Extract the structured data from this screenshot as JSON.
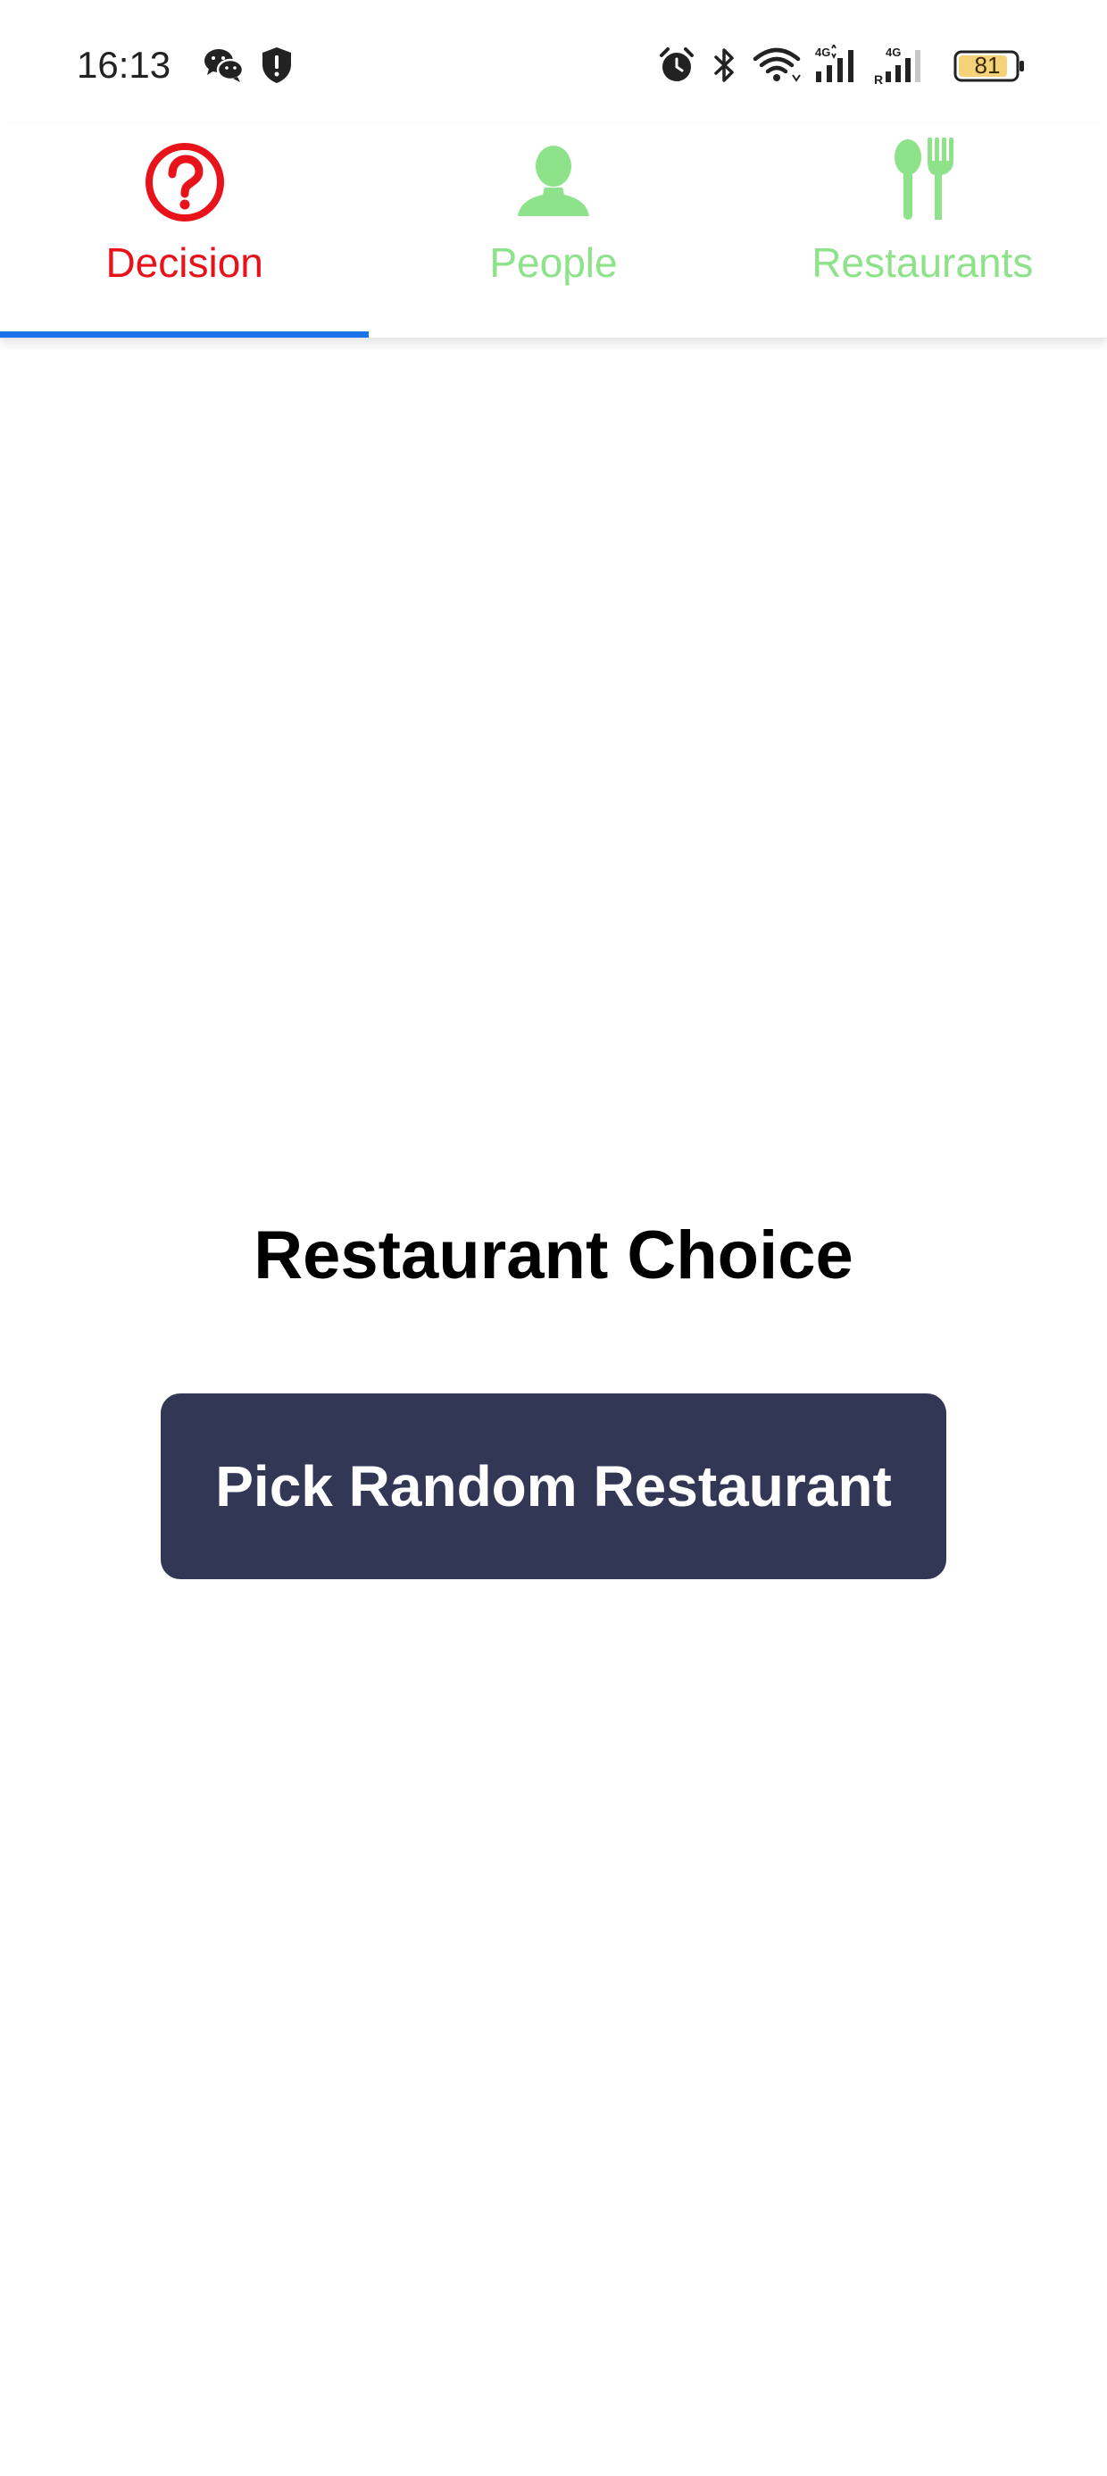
{
  "status_bar": {
    "time": "16:13",
    "battery_level": "81",
    "icons": [
      "wechat-icon",
      "shield-alert-icon",
      "alarm-icon",
      "bluetooth-icon",
      "wifi-icon",
      "signal-4g-icon",
      "signal-4g-roaming-icon",
      "battery-icon"
    ]
  },
  "tabs": [
    {
      "label": "Decision",
      "icon": "question-circle-icon",
      "active": true
    },
    {
      "label": "People",
      "icon": "person-icon",
      "active": false
    },
    {
      "label": "Restaurants",
      "icon": "fork-spoon-icon",
      "active": false
    }
  ],
  "main": {
    "title": "Restaurant Choice",
    "pick_button_label": "Pick Random Restaurant"
  },
  "colors": {
    "active_tab": "#e8121a",
    "inactive_tab": "#8ee38a",
    "tab_indicator": "#1a73e8",
    "button_bg": "#323755",
    "button_text": "#ffffff",
    "battery_fill": "#f3d27a"
  }
}
